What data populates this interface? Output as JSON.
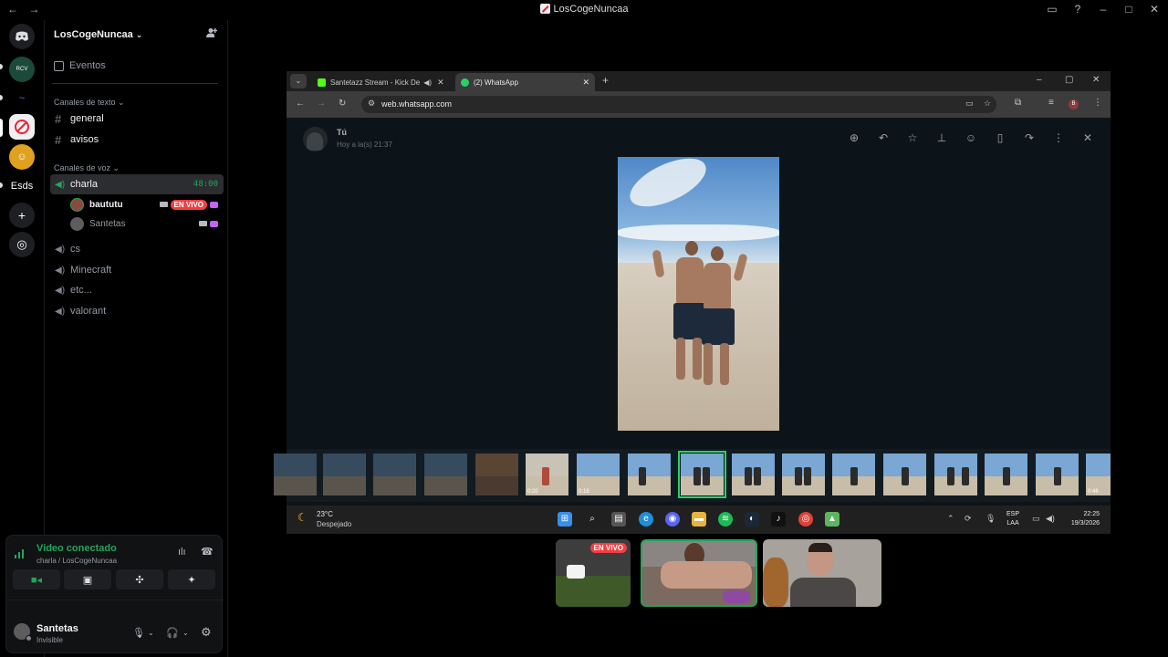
{
  "window": {
    "title": "LosCogeNuncaa",
    "back_forward": "← →"
  },
  "rail": {
    "server_label_esds": "Esds",
    "add_server": "+",
    "discover": "◎"
  },
  "guild": {
    "name": "LosCogeNuncaa",
    "events_label": "Eventos",
    "text_category": "Canales de texto",
    "voice_category": "Canales de voz",
    "text_channels": [
      "general",
      "avisos"
    ],
    "voice_channels": [
      "charla",
      "cs",
      "Minecraft",
      "etc...",
      "valorant"
    ],
    "active_voice_timer": "48:00",
    "voice_users": [
      {
        "name": "baututu",
        "live": "EN VIVO"
      },
      {
        "name": "Santetas"
      }
    ]
  },
  "voice_panel": {
    "status": "Video conectado",
    "location": "charla / LosCogeNuncaa"
  },
  "user": {
    "name": "Santetas",
    "status": "Invisible"
  },
  "browser": {
    "tabs": [
      {
        "label": "Santetazz Stream - Kick De",
        "favicon_color": "#53fc18"
      },
      {
        "label": "(2) WhatsApp",
        "favicon_color": "#25d366"
      }
    ],
    "url": "web.whatsapp.com",
    "profile_initial": "B"
  },
  "whatsapp": {
    "sender": "Tú",
    "time": "Hoy a la(s) 21:37",
    "thumb_durations": [
      "0:20",
      "0:16",
      "0:46"
    ]
  },
  "taskbar": {
    "temp": "23°C",
    "condition": "Despejado",
    "lang_1": "ESP",
    "lang_2": "LAA",
    "time": "22:25",
    "date": "19/3/2026"
  },
  "tiles": {
    "live_badge": "EN VIVO"
  },
  "colors": {
    "discord_green": "#23a55a",
    "live_red": "#f23f43",
    "whatsapp_green": "#25d366"
  }
}
